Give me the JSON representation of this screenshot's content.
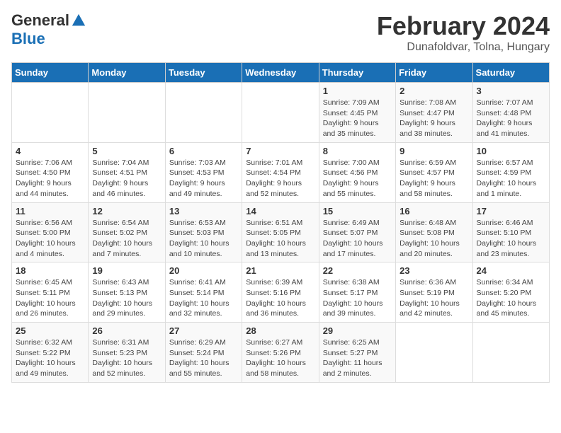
{
  "header": {
    "logo_general": "General",
    "logo_blue": "Blue",
    "main_title": "February 2024",
    "subtitle": "Dunafoldvar, Tolna, Hungary"
  },
  "days_of_week": [
    "Sunday",
    "Monday",
    "Tuesday",
    "Wednesday",
    "Thursday",
    "Friday",
    "Saturday"
  ],
  "weeks": [
    [
      {
        "day": "",
        "info": ""
      },
      {
        "day": "",
        "info": ""
      },
      {
        "day": "",
        "info": ""
      },
      {
        "day": "",
        "info": ""
      },
      {
        "day": "1",
        "info": "Sunrise: 7:09 AM\nSunset: 4:45 PM\nDaylight: 9 hours\nand 35 minutes."
      },
      {
        "day": "2",
        "info": "Sunrise: 7:08 AM\nSunset: 4:47 PM\nDaylight: 9 hours\nand 38 minutes."
      },
      {
        "day": "3",
        "info": "Sunrise: 7:07 AM\nSunset: 4:48 PM\nDaylight: 9 hours\nand 41 minutes."
      }
    ],
    [
      {
        "day": "4",
        "info": "Sunrise: 7:06 AM\nSunset: 4:50 PM\nDaylight: 9 hours\nand 44 minutes."
      },
      {
        "day": "5",
        "info": "Sunrise: 7:04 AM\nSunset: 4:51 PM\nDaylight: 9 hours\nand 46 minutes."
      },
      {
        "day": "6",
        "info": "Sunrise: 7:03 AM\nSunset: 4:53 PM\nDaylight: 9 hours\nand 49 minutes."
      },
      {
        "day": "7",
        "info": "Sunrise: 7:01 AM\nSunset: 4:54 PM\nDaylight: 9 hours\nand 52 minutes."
      },
      {
        "day": "8",
        "info": "Sunrise: 7:00 AM\nSunset: 4:56 PM\nDaylight: 9 hours\nand 55 minutes."
      },
      {
        "day": "9",
        "info": "Sunrise: 6:59 AM\nSunset: 4:57 PM\nDaylight: 9 hours\nand 58 minutes."
      },
      {
        "day": "10",
        "info": "Sunrise: 6:57 AM\nSunset: 4:59 PM\nDaylight: 10 hours\nand 1 minute."
      }
    ],
    [
      {
        "day": "11",
        "info": "Sunrise: 6:56 AM\nSunset: 5:00 PM\nDaylight: 10 hours\nand 4 minutes."
      },
      {
        "day": "12",
        "info": "Sunrise: 6:54 AM\nSunset: 5:02 PM\nDaylight: 10 hours\nand 7 minutes."
      },
      {
        "day": "13",
        "info": "Sunrise: 6:53 AM\nSunset: 5:03 PM\nDaylight: 10 hours\nand 10 minutes."
      },
      {
        "day": "14",
        "info": "Sunrise: 6:51 AM\nSunset: 5:05 PM\nDaylight: 10 hours\nand 13 minutes."
      },
      {
        "day": "15",
        "info": "Sunrise: 6:49 AM\nSunset: 5:07 PM\nDaylight: 10 hours\nand 17 minutes."
      },
      {
        "day": "16",
        "info": "Sunrise: 6:48 AM\nSunset: 5:08 PM\nDaylight: 10 hours\nand 20 minutes."
      },
      {
        "day": "17",
        "info": "Sunrise: 6:46 AM\nSunset: 5:10 PM\nDaylight: 10 hours\nand 23 minutes."
      }
    ],
    [
      {
        "day": "18",
        "info": "Sunrise: 6:45 AM\nSunset: 5:11 PM\nDaylight: 10 hours\nand 26 minutes."
      },
      {
        "day": "19",
        "info": "Sunrise: 6:43 AM\nSunset: 5:13 PM\nDaylight: 10 hours\nand 29 minutes."
      },
      {
        "day": "20",
        "info": "Sunrise: 6:41 AM\nSunset: 5:14 PM\nDaylight: 10 hours\nand 32 minutes."
      },
      {
        "day": "21",
        "info": "Sunrise: 6:39 AM\nSunset: 5:16 PM\nDaylight: 10 hours\nand 36 minutes."
      },
      {
        "day": "22",
        "info": "Sunrise: 6:38 AM\nSunset: 5:17 PM\nDaylight: 10 hours\nand 39 minutes."
      },
      {
        "day": "23",
        "info": "Sunrise: 6:36 AM\nSunset: 5:19 PM\nDaylight: 10 hours\nand 42 minutes."
      },
      {
        "day": "24",
        "info": "Sunrise: 6:34 AM\nSunset: 5:20 PM\nDaylight: 10 hours\nand 45 minutes."
      }
    ],
    [
      {
        "day": "25",
        "info": "Sunrise: 6:32 AM\nSunset: 5:22 PM\nDaylight: 10 hours\nand 49 minutes."
      },
      {
        "day": "26",
        "info": "Sunrise: 6:31 AM\nSunset: 5:23 PM\nDaylight: 10 hours\nand 52 minutes."
      },
      {
        "day": "27",
        "info": "Sunrise: 6:29 AM\nSunset: 5:24 PM\nDaylight: 10 hours\nand 55 minutes."
      },
      {
        "day": "28",
        "info": "Sunrise: 6:27 AM\nSunset: 5:26 PM\nDaylight: 10 hours\nand 58 minutes."
      },
      {
        "day": "29",
        "info": "Sunrise: 6:25 AM\nSunset: 5:27 PM\nDaylight: 11 hours\nand 2 minutes."
      },
      {
        "day": "",
        "info": ""
      },
      {
        "day": "",
        "info": ""
      }
    ]
  ]
}
